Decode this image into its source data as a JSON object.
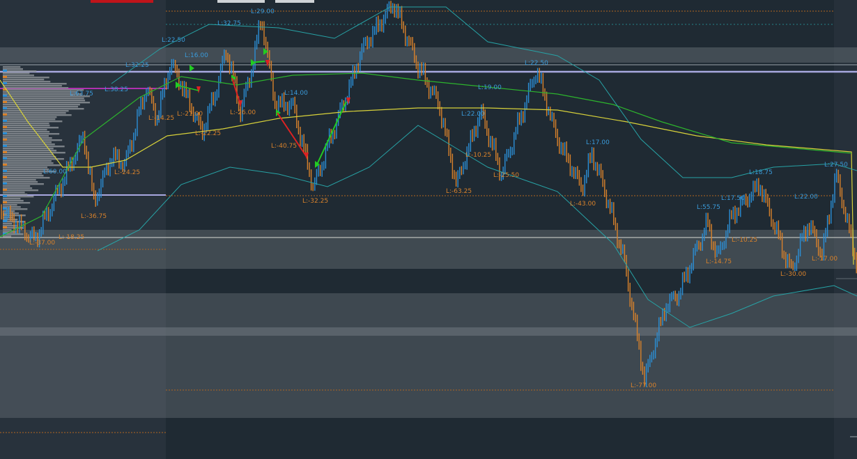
{
  "colors": {
    "background": "#1f2a33",
    "left_panel": "#28323c",
    "right_panel": "#26303a",
    "zone_band": "#6d767d",
    "up_bar": "#2b8fd6",
    "down_bar": "#d9822b",
    "high_label": "#3a9ad9",
    "low_label": "#d9822b",
    "green_ma": "#2db52d",
    "yellow_ma": "#d8d23a",
    "band_line": "#27a3a6",
    "lavender_line": "#a8a8e0",
    "orange_dotted": "#b3661f",
    "magenta_line": "#b030b0",
    "buy_arrow": "#22cc22",
    "sell_arrow": "#dd2222"
  },
  "chart_data": {
    "type": "bar",
    "description_series": "price swing pivots",
    "pivots": [
      {
        "label": "L:-37.00",
        "kind": "low"
      },
      {
        "label": "L:-18.25",
        "kind": "low"
      },
      {
        "label": "L:-36.75",
        "kind": "low"
      },
      {
        "label": "L:-24.25",
        "kind": "low"
      },
      {
        "label": "L:-14.25",
        "kind": "low"
      },
      {
        "label": "L:-21.00",
        "kind": "low"
      },
      {
        "label": "L:-22.25",
        "kind": "low"
      },
      {
        "label": "L:-26.00",
        "kind": "low"
      },
      {
        "label": "L:-40.75",
        "kind": "low"
      },
      {
        "label": "L:-32.25",
        "kind": "low"
      },
      {
        "label": "L:-63.25",
        "kind": "low"
      },
      {
        "label": "L:-10.25",
        "kind": "low"
      },
      {
        "label": "L:-25.50",
        "kind": "low"
      },
      {
        "label": "L:-43.00",
        "kind": "low"
      },
      {
        "label": "L:-77.00",
        "kind": "low"
      },
      {
        "label": "L:-14.75",
        "kind": "low"
      },
      {
        "label": "L:-10.25",
        "kind": "low"
      },
      {
        "label": "L:-30.00",
        "kind": "low"
      },
      {
        "label": "L:-17.00",
        "kind": "low"
      },
      {
        "label": "L:60.00",
        "kind": "high"
      },
      {
        "label": "L:63.75",
        "kind": "high"
      },
      {
        "label": "L:38.25",
        "kind": "high"
      },
      {
        "label": "L:32.25",
        "kind": "high"
      },
      {
        "label": "L:22.50",
        "kind": "high"
      },
      {
        "label": "L:16.00",
        "kind": "high"
      },
      {
        "label": "L:32.75",
        "kind": "high"
      },
      {
        "label": "L:29.00",
        "kind": "high"
      },
      {
        "label": "L:14.00",
        "kind": "high"
      },
      {
        "label": "L:19.00",
        "kind": "high"
      },
      {
        "label": "L:22.00",
        "kind": "high"
      },
      {
        "label": "L:22.50",
        "kind": "high"
      },
      {
        "label": "L:17.00",
        "kind": "high"
      },
      {
        "label": "L:55.75",
        "kind": "high"
      },
      {
        "label": "L:17.50",
        "kind": "high"
      },
      {
        "label": "L:18.75",
        "kind": "high"
      },
      {
        "label": "L:22.00",
        "kind": "high"
      },
      {
        "label": "L:27.50",
        "kind": "high"
      }
    ],
    "xlabel": "",
    "ylabel": "",
    "grid": false
  }
}
